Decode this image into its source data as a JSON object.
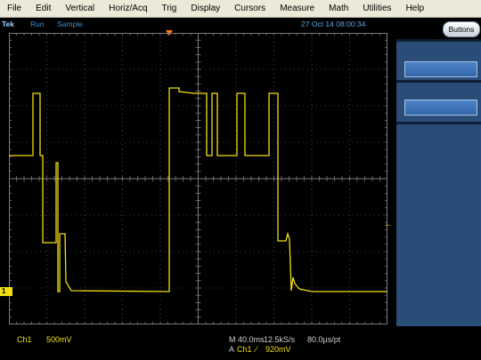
{
  "menu": [
    "File",
    "Edit",
    "Vertical",
    "Horiz/Acq",
    "Trig",
    "Display",
    "Cursors",
    "Measure",
    "Math",
    "Utilities",
    "Help"
  ],
  "status": {
    "brand": "Tek",
    "state": "Run",
    "acq_mode": "Sample",
    "datetime": "27 Oct 14 08:00:34"
  },
  "buttons_label": "Buttons",
  "channel_marker": "1",
  "trigger_level_marker": "←",
  "bottom": {
    "channel": "Ch1",
    "scale": "500mV",
    "timebase": "M 40.0ms",
    "sample_rate": "12.5kS/s",
    "record": "80.0µs/pt",
    "trigger_mode": "A",
    "trigger_source": "Ch1",
    "trigger_slope": "⁄",
    "trigger_level": "920mV"
  },
  "colors": {
    "trace": "#f0e010",
    "graticule": "#7a7a7a",
    "panel": "#2a4d78",
    "trigger": "#ff7a1a"
  }
}
